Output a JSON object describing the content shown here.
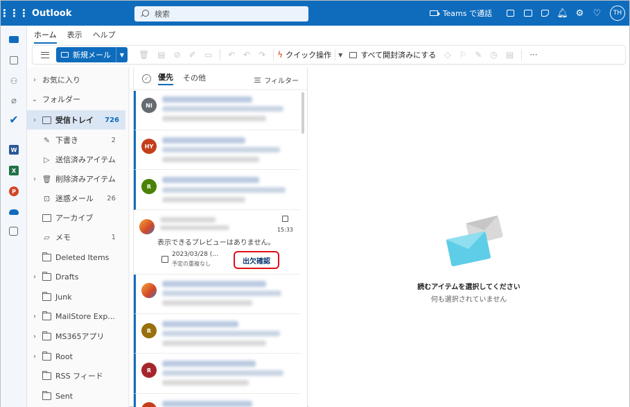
{
  "app": {
    "name": "Outlook",
    "user_initials": "TH"
  },
  "search": {
    "placeholder": "検索"
  },
  "topbar": {
    "teams_call": "Teams で通話"
  },
  "ribbon": {
    "tabs": [
      "ホーム",
      "表示",
      "ヘルプ"
    ]
  },
  "toolbar": {
    "new_mail": "新規メール",
    "quick_steps": "クイック操作",
    "mark_all_read": "すべて開封済みにする",
    "more": "···"
  },
  "folders": {
    "favorites": "お気に入り",
    "folders_header": "フォルダー",
    "items": [
      {
        "label": "受信トレイ",
        "count": "726"
      },
      {
        "label": "下書き",
        "count": "2"
      },
      {
        "label": "送信済みアイテム",
        "count": ""
      },
      {
        "label": "削除済みアイテム",
        "count": ""
      },
      {
        "label": "迷惑メール",
        "count": "26"
      },
      {
        "label": "アーカイブ",
        "count": ""
      },
      {
        "label": "メモ",
        "count": "1"
      },
      {
        "label": "Deleted Items",
        "count": ""
      },
      {
        "label": "Drafts",
        "count": ""
      },
      {
        "label": "Junk",
        "count": ""
      },
      {
        "label": "MailStore Exp...",
        "count": ""
      },
      {
        "label": "MS365アプリ",
        "count": ""
      },
      {
        "label": "Root",
        "count": ""
      },
      {
        "label": "RSS フィード",
        "count": ""
      },
      {
        "label": "Sent",
        "count": ""
      }
    ]
  },
  "message_list": {
    "tab_focused": "優先",
    "tab_other": "その他",
    "filter": "フィルター",
    "avatars": [
      "NI",
      "HY",
      "R",
      "",
      "",
      "R",
      "R"
    ],
    "meeting": {
      "time": "15:33",
      "preview": "表示できるプレビューはありません。",
      "date": "2023/03/28 (...",
      "conflict": "予定の重複なし",
      "rsvp": "出欠確認"
    }
  },
  "reading_pane": {
    "title": "読むアイテムを選択してください",
    "subtitle": "何も選択されていません"
  },
  "colors": {
    "brand": "#0f6cbd",
    "highlight": "#e0101a"
  }
}
